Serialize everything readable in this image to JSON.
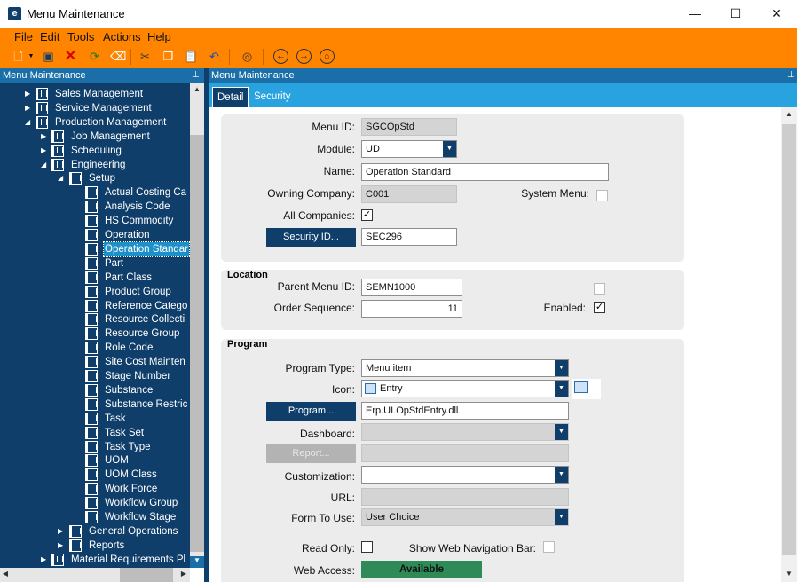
{
  "window": {
    "title": "Menu Maintenance",
    "minimize": "—",
    "maximize": "☐",
    "close": "✕"
  },
  "menubar": [
    "File",
    "Edit",
    "Tools",
    "Actions",
    "Help"
  ],
  "toolbar": [
    "new-icon",
    "save-icon",
    "delete-icon",
    "refresh-icon",
    "clear-icon",
    "cut-icon",
    "copy-icon",
    "paste-icon",
    "undo-icon",
    "binoculars-icon",
    "back-icon",
    "forward-icon",
    "home-icon"
  ],
  "left_pane": {
    "title": "Menu Maintenance"
  },
  "right_pane": {
    "title": "Menu Maintenance"
  },
  "tree": [
    {
      "label": "Sales Management",
      "level": 1,
      "state": "collapsed"
    },
    {
      "label": "Service Management",
      "level": 1,
      "state": "collapsed"
    },
    {
      "label": "Production Management",
      "level": 1,
      "state": "expanded"
    },
    {
      "label": "Job Management",
      "level": 2,
      "state": "collapsed"
    },
    {
      "label": "Scheduling",
      "level": 2,
      "state": "collapsed"
    },
    {
      "label": "Engineering",
      "level": 2,
      "state": "expanded"
    },
    {
      "label": "Setup",
      "level": 3,
      "state": "expanded"
    },
    {
      "label": "Actual Costing Ca",
      "level": 4,
      "state": "leaf"
    },
    {
      "label": "Analysis Code",
      "level": 4,
      "state": "leaf"
    },
    {
      "label": "HS Commodity",
      "level": 4,
      "state": "leaf"
    },
    {
      "label": "Operation",
      "level": 4,
      "state": "leaf"
    },
    {
      "label": "Operation Standar",
      "level": 4,
      "state": "leaf",
      "selected": true
    },
    {
      "label": "Part",
      "level": 4,
      "state": "leaf"
    },
    {
      "label": "Part Class",
      "level": 4,
      "state": "leaf"
    },
    {
      "label": "Product Group",
      "level": 4,
      "state": "leaf"
    },
    {
      "label": "Reference Catego",
      "level": 4,
      "state": "leaf"
    },
    {
      "label": "Resource Collecti",
      "level": 4,
      "state": "leaf"
    },
    {
      "label": "Resource Group",
      "level": 4,
      "state": "leaf"
    },
    {
      "label": "Role Code",
      "level": 4,
      "state": "leaf"
    },
    {
      "label": "Site Cost Mainten",
      "level": 4,
      "state": "leaf"
    },
    {
      "label": "Stage Number",
      "level": 4,
      "state": "leaf"
    },
    {
      "label": "Substance",
      "level": 4,
      "state": "leaf"
    },
    {
      "label": "Substance Restric",
      "level": 4,
      "state": "leaf"
    },
    {
      "label": "Task",
      "level": 4,
      "state": "leaf"
    },
    {
      "label": "Task Set",
      "level": 4,
      "state": "leaf"
    },
    {
      "label": "Task Type",
      "level": 4,
      "state": "leaf"
    },
    {
      "label": "UOM",
      "level": 4,
      "state": "leaf"
    },
    {
      "label": "UOM Class",
      "level": 4,
      "state": "leaf"
    },
    {
      "label": "Work Force",
      "level": 4,
      "state": "leaf"
    },
    {
      "label": "Workflow Group",
      "level": 4,
      "state": "leaf"
    },
    {
      "label": "Workflow Stage",
      "level": 4,
      "state": "leaf"
    },
    {
      "label": "General Operations",
      "level": 3,
      "state": "collapsed"
    },
    {
      "label": "Reports",
      "level": 3,
      "state": "collapsed"
    },
    {
      "label": "Material Requirements Pl",
      "level": 2,
      "state": "collapsed"
    }
  ],
  "tabs": [
    "Detail",
    "Security"
  ],
  "detail": {
    "menu_id_label": "Menu ID:",
    "menu_id": "SGCOpStd",
    "module_label": "Module:",
    "module": "UD",
    "name_label": "Name:",
    "name": "Operation Standard",
    "owning_company_label": "Owning Company:",
    "owning_company": "C001",
    "system_menu_label": "System Menu:",
    "system_menu": false,
    "all_companies_label": "All Companies:",
    "all_companies": true,
    "security_id_button": "Security ID...",
    "security_id": "SEC296"
  },
  "location": {
    "title": "Location",
    "parent_menu_id_label": "Parent Menu ID:",
    "parent_menu_id": "SEMN1000",
    "order_sequence_label": "Order Sequence:",
    "order_sequence": "11",
    "enabled_label": "Enabled:",
    "enabled": true
  },
  "program": {
    "title": "Program",
    "program_type_label": "Program Type:",
    "program_type": "Menu item",
    "icon_label": "Icon:",
    "icon": "Entry",
    "program_button": "Program...",
    "program": "Erp.UI.OpStdEntry.dll",
    "dashboard_label": "Dashboard:",
    "dashboard": "",
    "report_button": "Report...",
    "report": "",
    "customization_label": "Customization:",
    "customization": "",
    "url_label": "URL:",
    "url": "",
    "form_to_use_label": "Form To Use:",
    "form_to_use": "User Choice",
    "read_only_label": "Read Only:",
    "read_only": false,
    "show_web_nav_label": "Show Web Navigation Bar:",
    "show_web_nav": false,
    "web_access_label": "Web Access:",
    "web_access": "Available"
  },
  "colors": {
    "orange": "#ff8400",
    "navy": "#0f3e6a",
    "tab_blue": "#29a3e0",
    "header_blue": "#1a6fa8",
    "available_green": "#2e8b57"
  }
}
